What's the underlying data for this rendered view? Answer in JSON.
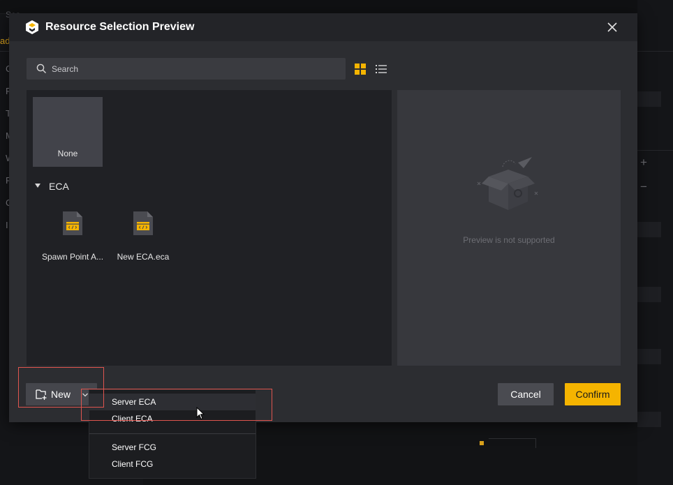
{
  "background": {
    "search_label": "Sea",
    "tab_label": "ade",
    "left_initials": [
      "C",
      "P",
      "T",
      "M",
      "W",
      "F",
      "C",
      "I"
    ]
  },
  "dialog": {
    "title": "Resource Selection Preview",
    "close_icon": "close-icon",
    "search": {
      "placeholder": "Search",
      "value": ""
    },
    "view_modes": {
      "active": "grid",
      "grid_icon": "grid-view-icon",
      "list_icon": "list-view-icon"
    },
    "colors": {
      "accent": "#f5b400",
      "panel": "#202125",
      "preview_panel": "#37383d"
    },
    "none_tile": {
      "label": "None"
    },
    "section": {
      "label": "ECA",
      "expanded": true
    },
    "files": [
      {
        "label": "Spawn Point A...",
        "icon": "eca-file-icon"
      },
      {
        "label": "New ECA.eca",
        "icon": "eca-file-icon"
      }
    ],
    "preview": {
      "message": "Preview is not supported",
      "icon": "empty-box-icon"
    },
    "new_button": {
      "label": "New"
    },
    "cancel_button": {
      "label": "Cancel"
    },
    "confirm_button": {
      "label": "Confirm"
    }
  },
  "dropdown": {
    "items": [
      {
        "label": "Server ECA",
        "hovered": true
      },
      {
        "label": "Client ECA",
        "hovered": false
      },
      {
        "label": "Server FCG",
        "hovered": false
      },
      {
        "label": "Client FCG",
        "hovered": false
      }
    ]
  }
}
